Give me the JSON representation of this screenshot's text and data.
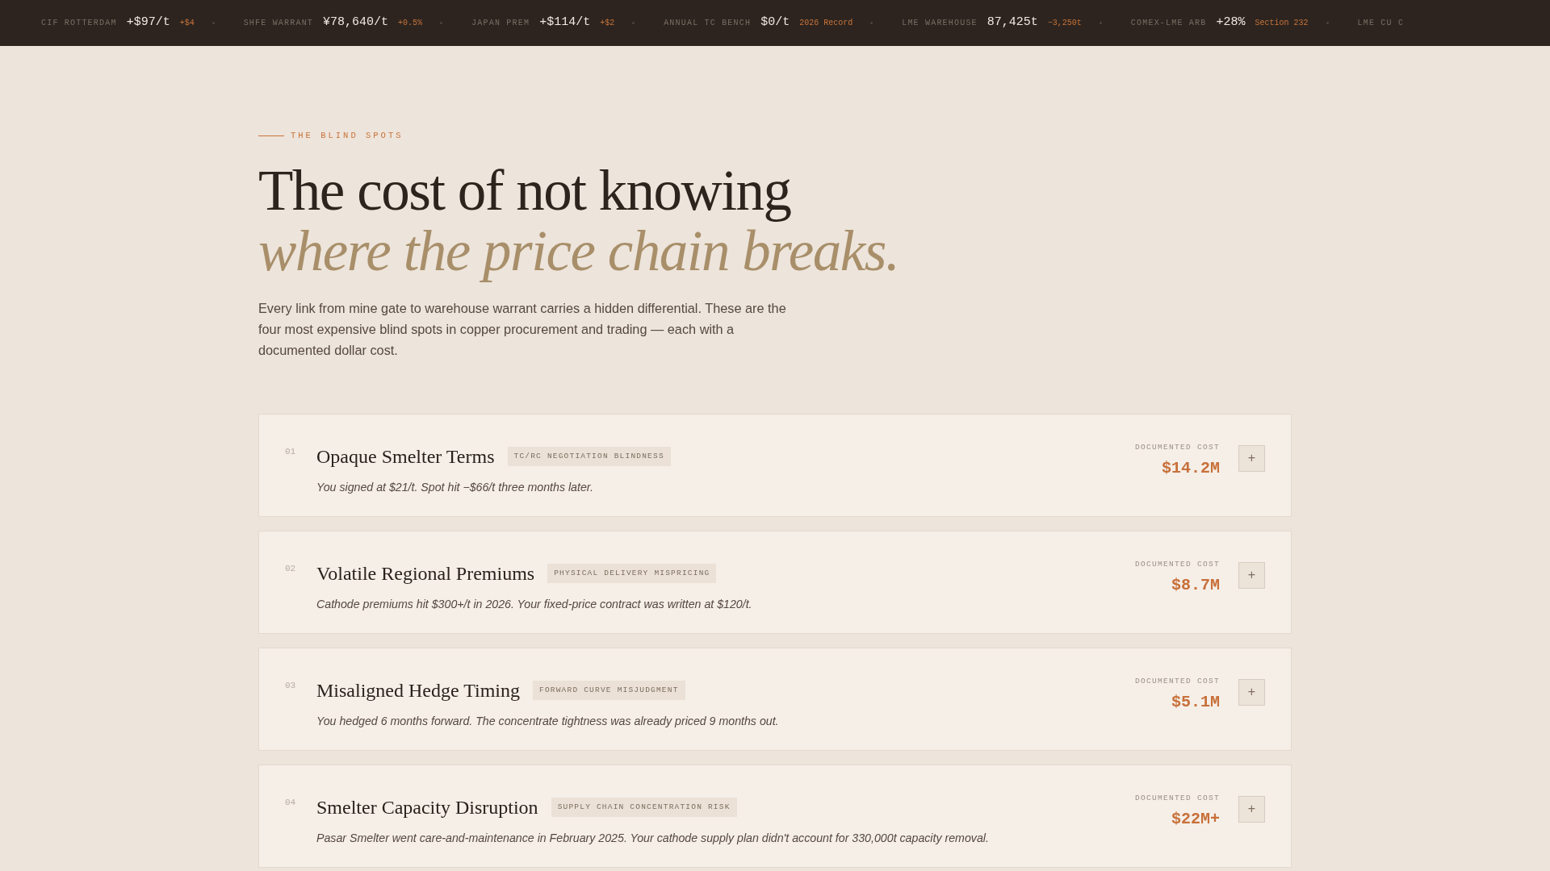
{
  "ticker": [
    {
      "label": "CIF ROTTERDAM",
      "value": "+$97/t",
      "change": "+$4"
    },
    {
      "label": "SHFE WARRANT",
      "value": "¥78,640/t",
      "change": "+0.5%"
    },
    {
      "label": "JAPAN PREM",
      "value": "+$114/t",
      "change": "+$2"
    },
    {
      "label": "ANNUAL TC BENCH",
      "value": "$0/t",
      "change": "2026 Record"
    },
    {
      "label": "LME WAREHOUSE",
      "value": "87,425t",
      "change": "−3,250t"
    },
    {
      "label": "COMEX-LME ARB",
      "value": "+28%",
      "change": "Section 232"
    },
    {
      "label": "LME CU C"
    }
  ],
  "section": {
    "eyebrow": "THE BLIND SPOTS",
    "title_line1": "The cost of not knowing",
    "title_line2": "where the price chain breaks.",
    "intro": "Every link from mine gate to warehouse warrant carries a hidden differential. These are the four most expensive blind spots in copper procurement and trading — each with a documented dollar cost."
  },
  "cards": [
    {
      "number": "01",
      "title": "Opaque Smelter Terms",
      "tag": "TC/RC NEGOTIATION BLINDNESS",
      "summary": "You signed at $21/t. Spot hit −$66/t three months later.",
      "cost_label": "DOCUMENTED COST",
      "cost": "$14.2M",
      "button": "+",
      "expanded": false
    },
    {
      "number": "02",
      "title": "Volatile Regional Premiums",
      "tag": "PHYSICAL DELIVERY MISPRICING",
      "summary": "Cathode premiums hit $300+/t in 2026. Your fixed-price contract was written at $120/t.",
      "cost_label": "DOCUMENTED COST",
      "cost": "$8.7M",
      "button": "+",
      "expanded": false
    },
    {
      "number": "03",
      "title": "Misaligned Hedge Timing",
      "tag": "FORWARD CURVE MISJUDGMENT",
      "summary": "You hedged 6 months forward. The concentrate tightness was already priced 9 months out.",
      "cost_label": "DOCUMENTED COST",
      "cost": "$5.1M",
      "button": "+",
      "expanded": false
    },
    {
      "number": "04",
      "title": "Smelter Capacity Disruption",
      "tag": "SUPPLY CHAIN CONCENTRATION RISK",
      "summary": "Pasar Smelter went care-and-maintenance in February 2025. Your cathode supply plan didn't account for 330,000t capacity removal.",
      "cost_label": "DOCUMENTED COST",
      "cost": "$22M+",
      "button": "+",
      "expanded": false
    }
  ]
}
